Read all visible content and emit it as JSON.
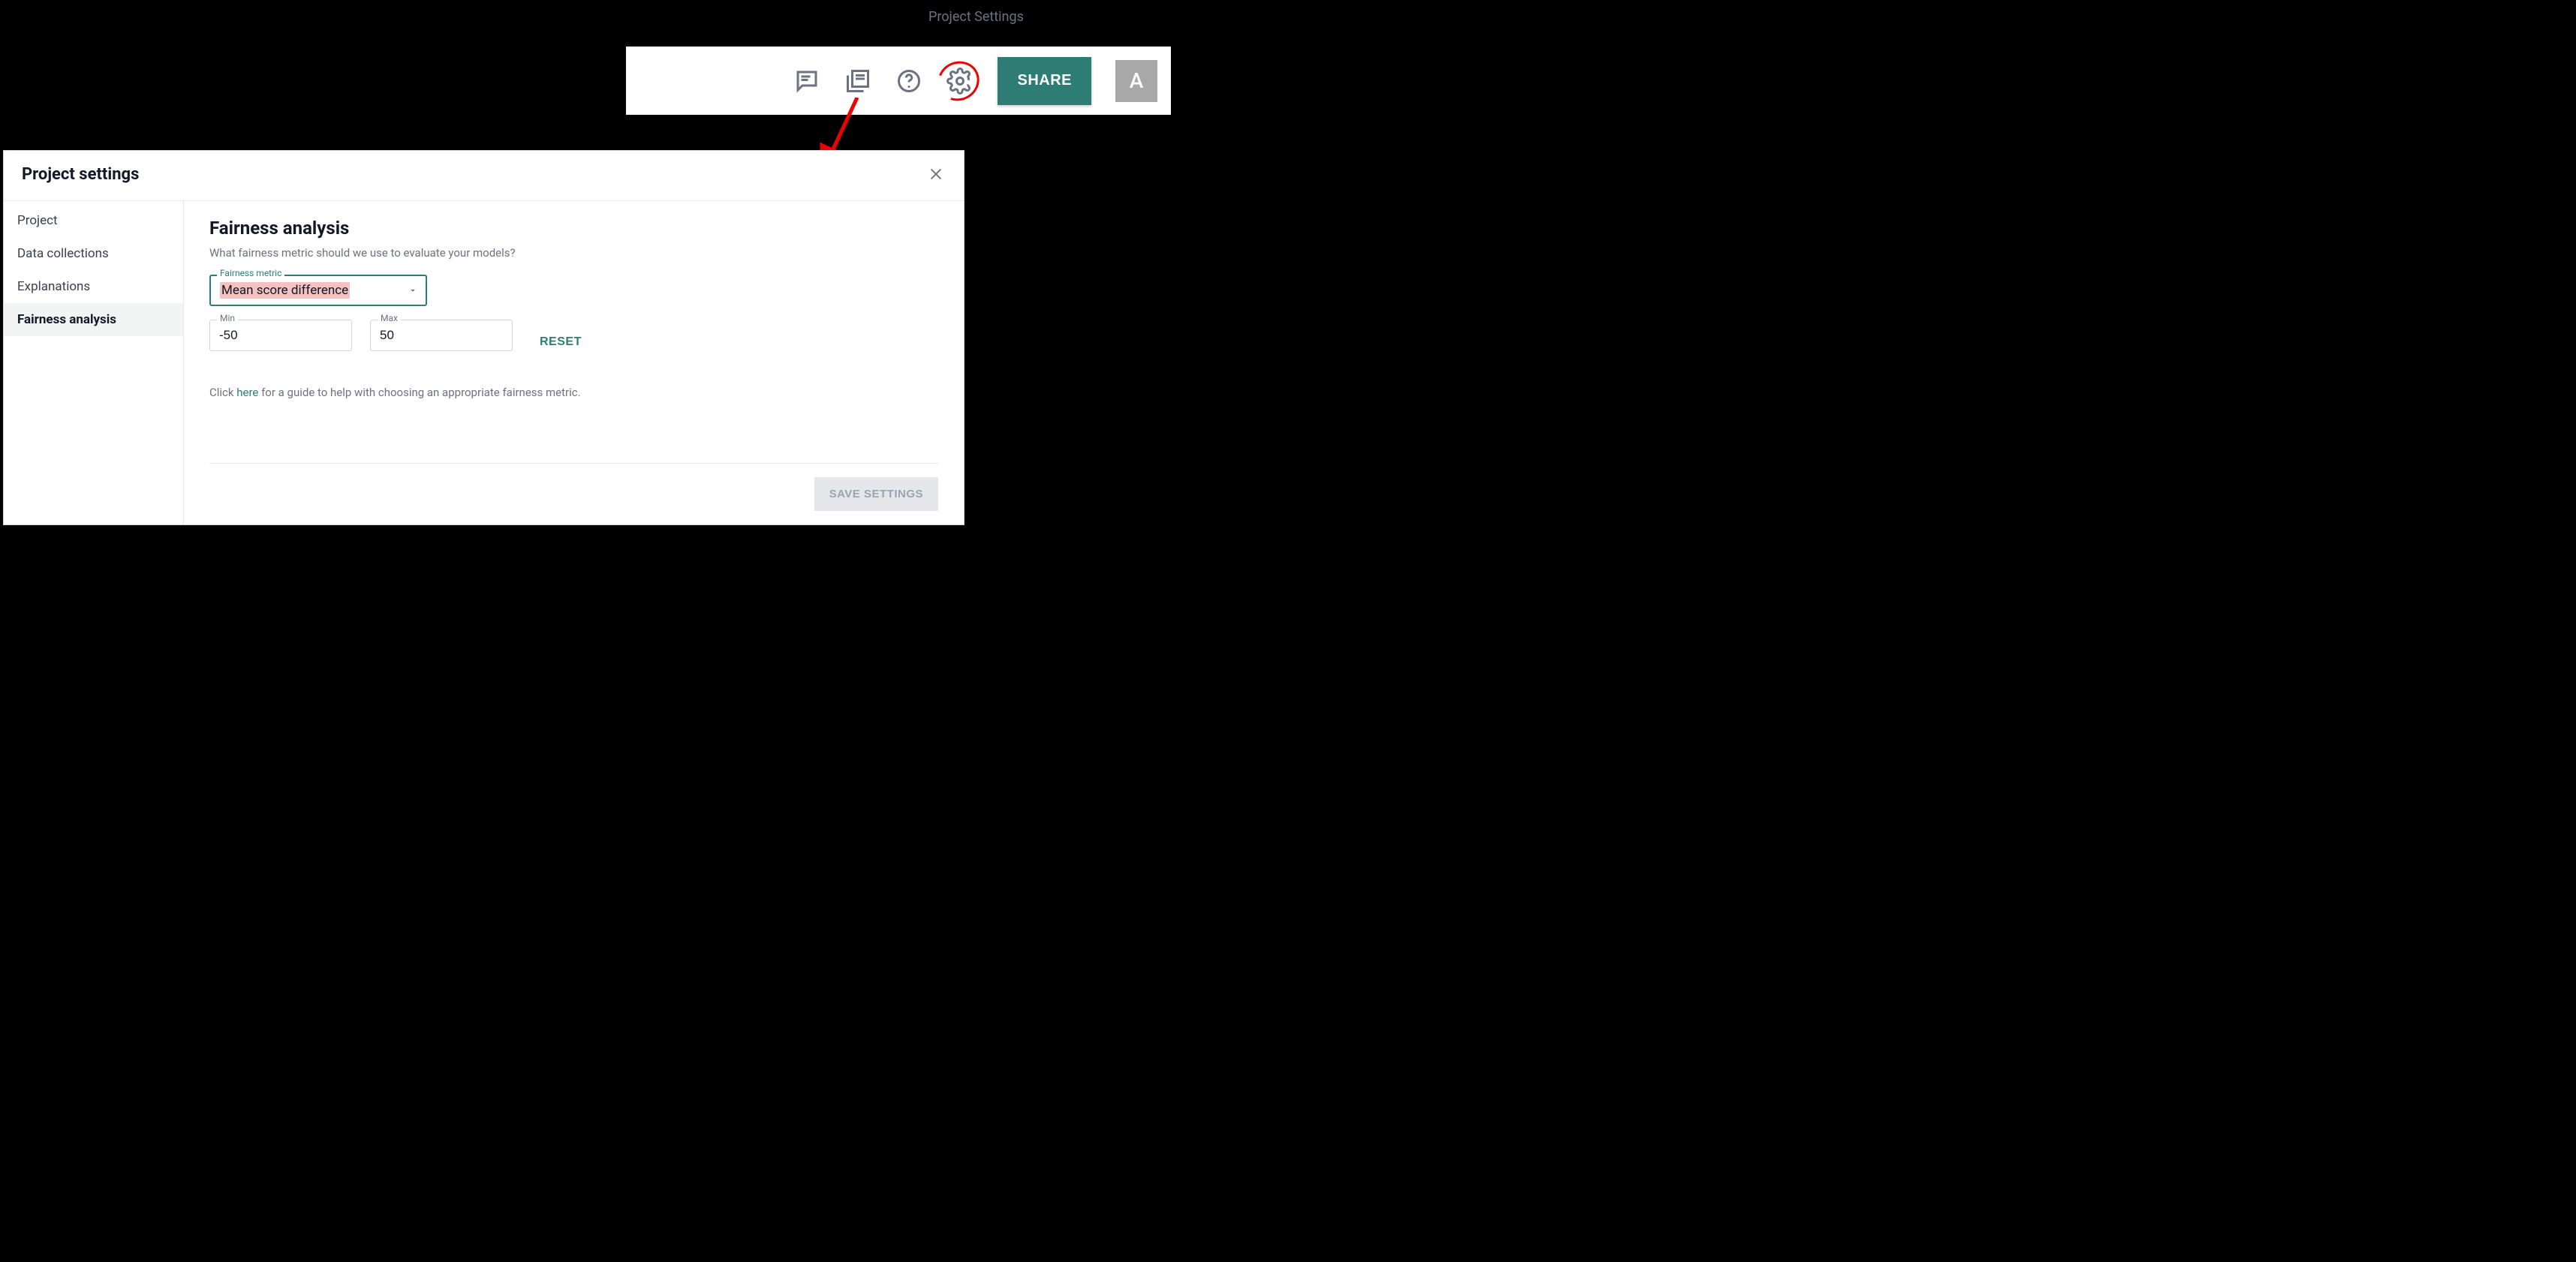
{
  "annotation": {
    "label": "Project Settings"
  },
  "toolbar": {
    "share_label": "SHARE",
    "avatar_letter": "A"
  },
  "modal": {
    "title": "Project settings",
    "sidebar": {
      "items": [
        {
          "label": "Project"
        },
        {
          "label": "Data collections"
        },
        {
          "label": "Explanations"
        },
        {
          "label": "Fairness analysis"
        }
      ]
    },
    "content": {
      "title": "Fairness analysis",
      "subtitle": "What fairness metric should we use to evaluate your models?",
      "metric_label": "Fairness metric",
      "metric_value": "Mean score difference",
      "min_label": "Min",
      "min_value": "-50",
      "max_label": "Max",
      "max_value": "50",
      "reset_label": "RESET",
      "help_prefix": "Click ",
      "help_link": "here",
      "help_suffix": " for a guide to help with choosing an appropriate fairness metric."
    },
    "footer": {
      "save_label": "SAVE SETTINGS"
    }
  }
}
